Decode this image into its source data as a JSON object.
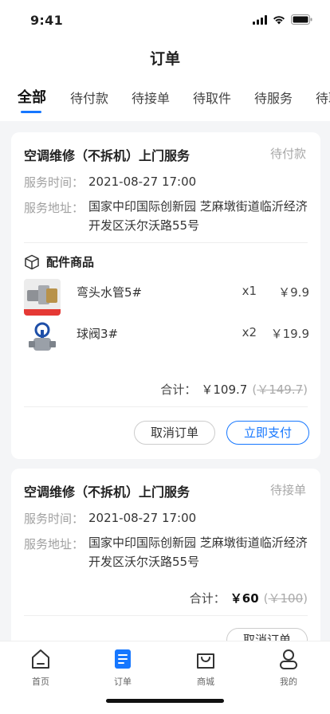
{
  "status_bar": {
    "time": "9:41"
  },
  "header": {
    "title": "订单"
  },
  "tabs": [
    {
      "label": "全部",
      "active": true
    },
    {
      "label": "待付款"
    },
    {
      "label": "待接单"
    },
    {
      "label": "待取件"
    },
    {
      "label": "待服务"
    },
    {
      "label": "待取"
    }
  ],
  "orders": [
    {
      "title": "空调维修（不拆机）上门服务",
      "status": "待付款",
      "time_label": "服务时间：",
      "time_value": "2021-08-27 17:00",
      "address_label": "服务地址：",
      "address_value": "国家中印国际创新园 芝麻墩街道临沂经济开发区沃尔沃路55号",
      "parts_heading": "配件商品",
      "parts": [
        {
          "name": "弯头水管5#",
          "qty": "x1",
          "price": "￥9.9",
          "icon": "elbow-pipe-thumbnail"
        },
        {
          "name": "球阀3#",
          "qty": "x2",
          "price": "￥19.9",
          "icon": "ball-valve-thumbnail"
        }
      ],
      "total_label": "合计：",
      "total_price": "￥109.7",
      "original_price": "￥149.7",
      "cancel_label": "取消订单",
      "pay_label": "立即支付"
    },
    {
      "title": "空调维修（不拆机）上门服务",
      "status": "待接单",
      "time_label": "服务时间：",
      "time_value": "2021-08-27 17:00",
      "address_label": "服务地址：",
      "address_value": "国家中印国际创新园 芝麻墩街道临沂经济开发区沃尔沃路55号",
      "total_label": "合计：",
      "total_price": "￥60",
      "original_price": "￥100",
      "cancel_label": "取消订单"
    }
  ],
  "tabbar": [
    {
      "label": "首页",
      "icon": "home-icon"
    },
    {
      "label": "订单",
      "icon": "orders-icon",
      "active": true
    },
    {
      "label": "商城",
      "icon": "shopping-bag-icon"
    },
    {
      "label": "我的",
      "icon": "profile-icon"
    }
  ],
  "colors": {
    "accent": "#1677ff",
    "background": "#f4f5f7"
  }
}
